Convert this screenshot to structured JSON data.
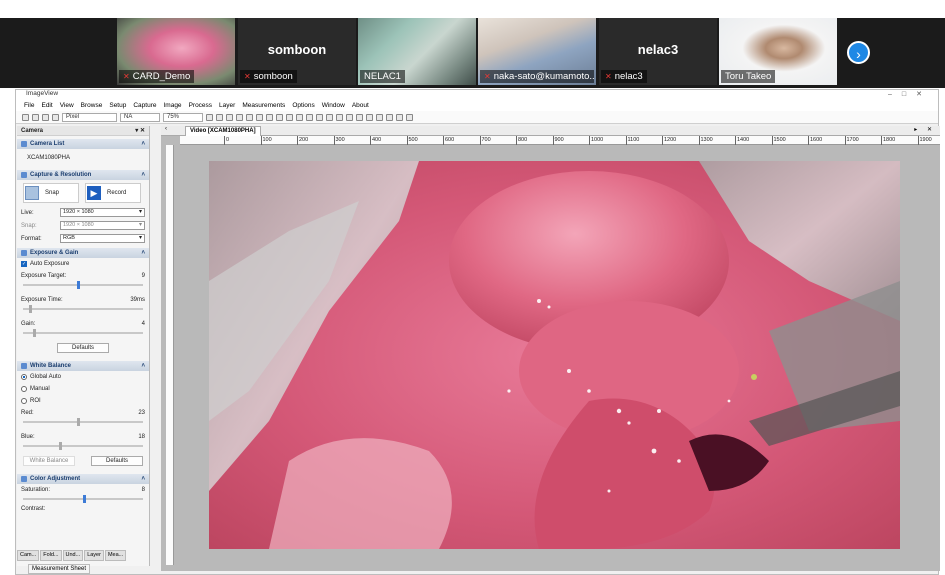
{
  "meeting": {
    "participants": [
      {
        "label": "CARD_Demo",
        "muted": true,
        "active": true,
        "video": true
      },
      {
        "label": "somboon",
        "display_name": "somboon",
        "muted": true,
        "video": false
      },
      {
        "label": "NELAC1",
        "muted": false,
        "video": true
      },
      {
        "label": "naka-sato@kumamoto...",
        "muted": true,
        "video": true
      },
      {
        "label": "nelac3",
        "display_name": "nelac3",
        "muted": true,
        "video": false
      },
      {
        "label": "Toru Takeo",
        "muted": false,
        "video": true
      }
    ],
    "next_icon": "chevron-right-icon"
  },
  "app": {
    "title": "ImageView",
    "menu": [
      "File",
      "Edit",
      "View",
      "Browse",
      "Setup",
      "Capture",
      "Image",
      "Process",
      "Layer",
      "Measurements",
      "Options",
      "Window",
      "About"
    ],
    "toolbar": {
      "unit": "Pixel",
      "magnification": "NA",
      "zoom": "75%"
    },
    "left_panel": {
      "title": "Camera",
      "camera_list": {
        "header": "Camera List",
        "camera": "XCAM1080PHA"
      },
      "capture": {
        "header": "Capture & Resolution",
        "snap": "Snap",
        "record": "Record",
        "live_label": "Live:",
        "live_value": "1920 × 1080",
        "snap_label": "Snap:",
        "snap_value": "1920 × 1080",
        "format_label": "Format:",
        "format_value": "RGB"
      },
      "exposure": {
        "header": "Exposure & Gain",
        "auto": "Auto Exposure",
        "target_label": "Exposure Target:",
        "target_value": "9",
        "time_label": "Exposure Time:",
        "time_value": "39ms",
        "gain_label": "Gain:",
        "gain_value": "4",
        "defaults": "Defaults",
        "target_frac": 0.45,
        "time_frac": 0.05,
        "gain_frac": 0.08
      },
      "white_balance": {
        "header": "White Balance",
        "global": "Global Auto",
        "manual": "Manual",
        "roi": "ROI",
        "red_label": "Red:",
        "red_value": "23",
        "blue_label": "Blue:",
        "blue_value": "18",
        "wb_btn": "White Balance",
        "defaults": "Defaults",
        "red_frac": 0.45,
        "blue_frac": 0.3
      },
      "color": {
        "header": "Color Adjustment",
        "saturation_label": "Saturation:",
        "saturation_value": "8",
        "contrast_label": "Contrast:",
        "saturation_frac": 0.5
      }
    },
    "bottom_tabs": [
      "Cam...",
      "Fold...",
      "Und...",
      "Layer",
      "Mea..."
    ],
    "measurement_tab": "Measurement Sheet",
    "video_tab": "Video [XCAM1080PHA]",
    "ruler_ticks": [
      "0",
      "100",
      "200",
      "300",
      "400",
      "500",
      "600",
      "700",
      "800",
      "900",
      "1000",
      "1100",
      "1200",
      "1300",
      "1400",
      "1500",
      "1600",
      "1700",
      "1800",
      "1900"
    ]
  }
}
